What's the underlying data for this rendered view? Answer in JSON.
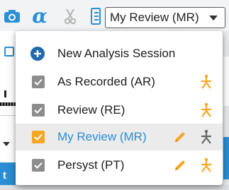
{
  "toolbar": {
    "selected_review": "My Review (MR)",
    "alpha_symbol": "α",
    "icons": [
      "camera-icon",
      "alpha-icon",
      "scissors-icon",
      "document-icon"
    ]
  },
  "background": {
    "left_button_fragment": "t"
  },
  "menu": {
    "new_session_label": "New Analysis Session",
    "items": [
      {
        "label": "As Recorded (AR)",
        "checked": true,
        "checkbox_color": "#8c8c8c",
        "editable": false,
        "selected": false
      },
      {
        "label": "Review (RE)",
        "checked": true,
        "checkbox_color": "#8c8c8c",
        "editable": false,
        "selected": false
      },
      {
        "label": "My Review (MR)",
        "checked": true,
        "checkbox_color": "#f5a623",
        "editable": true,
        "selected": true
      },
      {
        "label": "Persyst (PT)",
        "checked": true,
        "checkbox_color": "#8c8c8c",
        "editable": true,
        "selected": false
      }
    ]
  },
  "colors": {
    "accent_blue": "#2a8fd4",
    "accent_orange": "#f5a623",
    "add_button_blue": "#1e6aab",
    "selected_row_bg": "#ebebeb"
  }
}
